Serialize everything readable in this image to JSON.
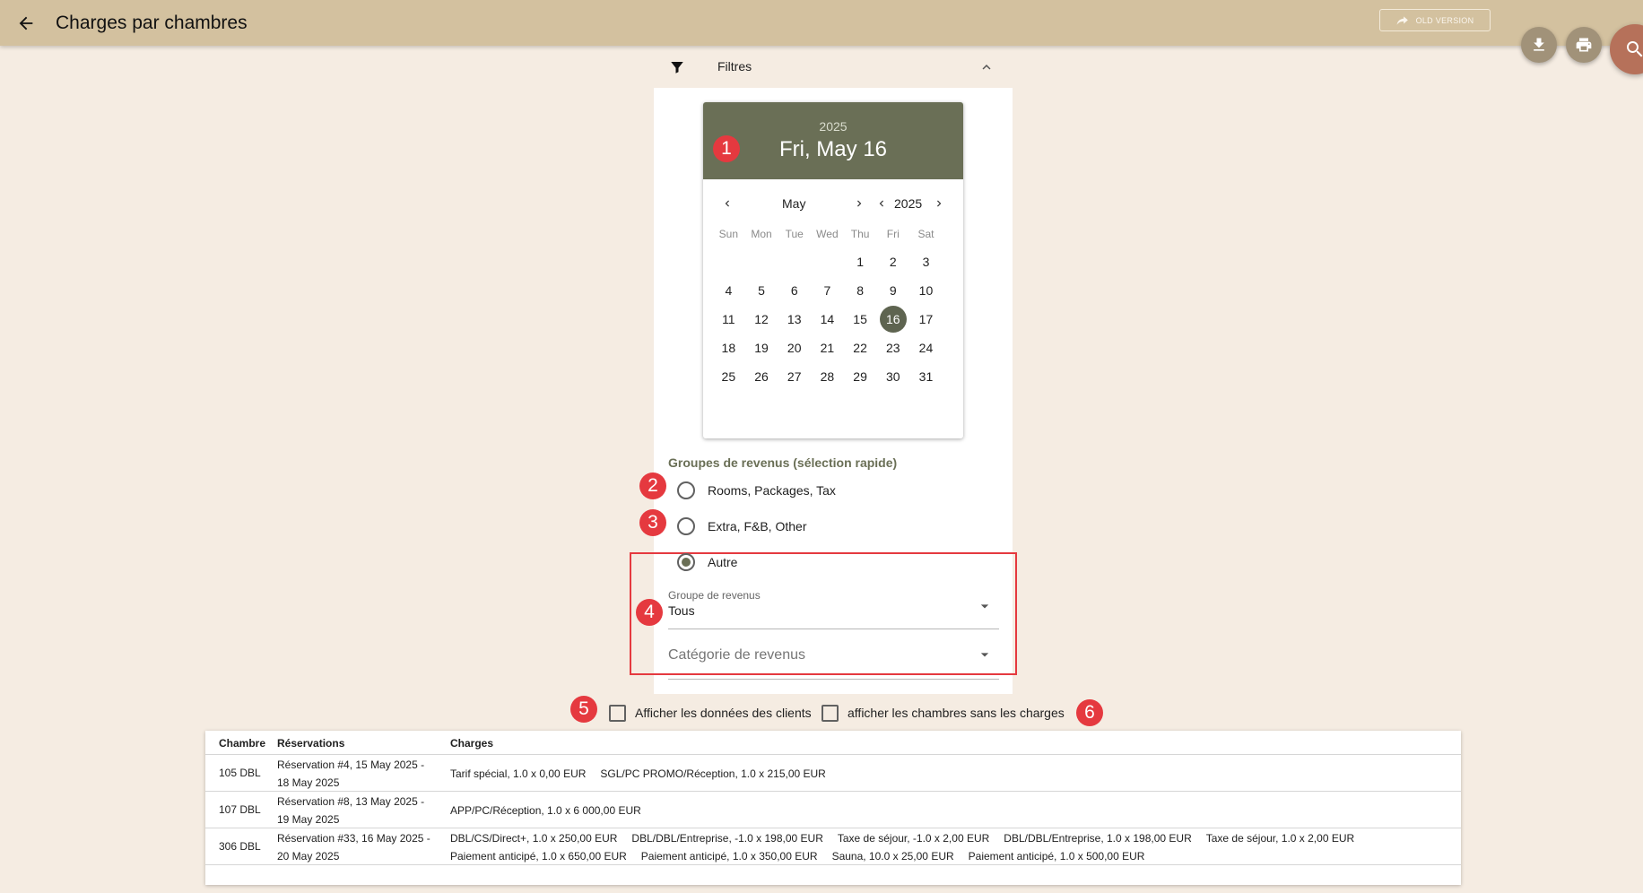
{
  "header": {
    "title": "Charges par chambres",
    "old_version_label": "OLD VERSION"
  },
  "filters": {
    "label": "Filtres",
    "datepicker": {
      "header_year": "2025",
      "header_date": "Fri, May 16",
      "month": "May",
      "year": "2025",
      "weekdays": [
        "Sun",
        "Mon",
        "Tue",
        "Wed",
        "Thu",
        "Fri",
        "Sat"
      ],
      "selected_day": "16",
      "weeks": [
        [
          "",
          "",
          "",
          "",
          "1",
          "2",
          "3"
        ],
        [
          "4",
          "5",
          "6",
          "7",
          "8",
          "9",
          "10"
        ],
        [
          "11",
          "12",
          "13",
          "14",
          "15",
          "16",
          "17"
        ],
        [
          "18",
          "19",
          "20",
          "21",
          "22",
          "23",
          "24"
        ],
        [
          "25",
          "26",
          "27",
          "28",
          "29",
          "30",
          "31"
        ]
      ]
    },
    "revenue_groups_title": "Groupes de revenus (sélection rapide)",
    "radios": [
      {
        "label": "Rooms, Packages, Tax",
        "checked": false
      },
      {
        "label": "Extra, F&B, Other",
        "checked": false
      },
      {
        "label": "Autre",
        "checked": true
      }
    ],
    "groupe_field": {
      "label": "Groupe de revenus",
      "value": "Tous"
    },
    "categorie_field": {
      "placeholder": "Catégorie de revenus"
    },
    "checkbox_clients": "Afficher les données des clients",
    "checkbox_empty_rooms": "afficher les chambres sans les charges"
  },
  "annotations": [
    "1",
    "2",
    "3",
    "4",
    "5",
    "6"
  ],
  "table": {
    "columns": [
      "Chambre",
      "Réservations",
      "Charges"
    ],
    "rows": [
      {
        "room": "105 DBL",
        "reservation": "Réservation #4, 15 May 2025 - 18 May 2025",
        "charges": [
          "Tarif spécial, 1.0 x 0,00 EUR",
          "SGL/PC PROMO/Réception, 1.0 x 215,00 EUR"
        ]
      },
      {
        "room": "107 DBL",
        "reservation": "Réservation #8, 13 May 2025 - 19 May 2025",
        "charges": [
          "APP/PC/Réception, 1.0 x 6 000,00 EUR"
        ]
      },
      {
        "room": "306 DBL",
        "reservation": "Réservation #33, 16 May 2025 - 20 May 2025",
        "charges": [
          "DBL/CS/Direct+, 1.0 x 250,00 EUR",
          "DBL/DBL/Entreprise, -1.0 x 198,00 EUR",
          "Taxe de séjour, -1.0 x 2,00 EUR",
          "DBL/DBL/Entreprise, 1.0 x 198,00 EUR",
          "Taxe de séjour, 1.0 x 2,00 EUR",
          "Paiement anticipé, 1.0 x 650,00 EUR",
          "Paiement anticipé, 1.0 x 350,00 EUR",
          "Sauna, 10.0 x 25,00 EUR",
          "Paiement anticipé, 1.0 x 500,00 EUR"
        ]
      }
    ]
  },
  "colors": {
    "appbar": "#d3c19f",
    "background": "#f5ece2",
    "accent": "#6a6f56",
    "annotation_red": "#e5393f"
  }
}
